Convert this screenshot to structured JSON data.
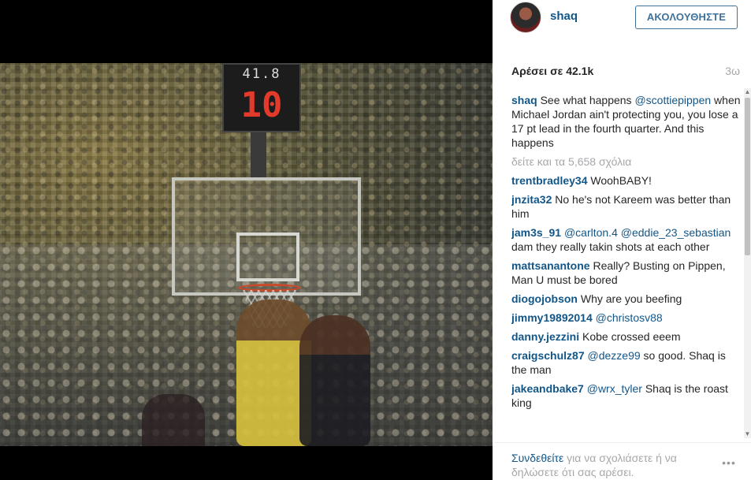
{
  "media": {
    "shot_clock_top": "41.8",
    "shot_clock_main": "10"
  },
  "post": {
    "username": "shaq",
    "follow_label": "ΑΚΟΛΟΥΘΗΣΤΕ",
    "likes_text": "Αρέσει σε 42.1k",
    "time_ago": "3ω"
  },
  "caption": {
    "username": "shaq",
    "text_before": " See what happens ",
    "mention": "@scottiepippen",
    "text_after": " when Michael Jordan ain't protecting you, you lose a 17 pt lead in the fourth quarter. And this happens"
  },
  "view_all_comments": "δείτε και τα 5,658 σχόλια",
  "comments": [
    {
      "username": "trentbradley34",
      "parts": [
        {
          "text": " WoohBABY!"
        }
      ]
    },
    {
      "username": "jnzita32",
      "parts": [
        {
          "text": " No he's not Kareem was better than him"
        }
      ]
    },
    {
      "username": "jam3s_91",
      "parts": [
        {
          "text": " "
        },
        {
          "mention": "@carlton.4"
        },
        {
          "text": " "
        },
        {
          "mention": "@eddie_23_sebastian"
        },
        {
          "text": " dam they really takin shots at each other"
        }
      ]
    },
    {
      "username": "mattsanantone",
      "parts": [
        {
          "text": " Really? Busting on Pippen, Man U must be bored"
        }
      ]
    },
    {
      "username": "diogojobson",
      "parts": [
        {
          "text": " Why are you beefing"
        }
      ]
    },
    {
      "username": "jimmy19892014",
      "parts": [
        {
          "text": " "
        },
        {
          "mention": "@christosv88"
        }
      ]
    },
    {
      "username": "danny.jezzini",
      "parts": [
        {
          "text": " Kobe crossed eeem"
        }
      ]
    },
    {
      "username": "craigschulz87",
      "parts": [
        {
          "text": " "
        },
        {
          "mention": "@dezze99"
        },
        {
          "text": " so good. Shaq is the man"
        }
      ]
    },
    {
      "username": "jakeandbake7",
      "parts": [
        {
          "text": " "
        },
        {
          "mention": "@wrx_tyler"
        },
        {
          "text": " Shaq is the roast king"
        }
      ]
    }
  ],
  "footer": {
    "login_link": "Συνδεθείτε",
    "rest_text": " για να σχολιάσετε ή να δηλώσετε ότι σας αρέσει.",
    "more_label": "•••"
  },
  "icons": {
    "scroll_up": "scroll-up-arrow-icon",
    "scroll_down": "scroll-down-arrow-icon",
    "more": "more-options-icon"
  }
}
